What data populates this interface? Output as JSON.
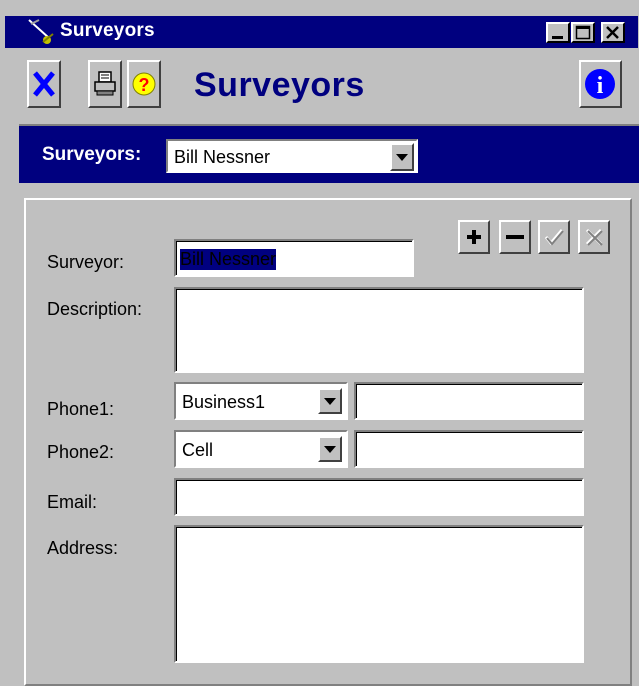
{
  "window": {
    "title": "Surveyors"
  },
  "toolbar": {
    "close_icon": "x-icon",
    "print_icon": "printer-icon",
    "help_icon": "question-icon",
    "info_icon": "info-icon",
    "form_title": "Surveyors"
  },
  "header": {
    "label": "Surveyors:",
    "selected": "Bill Nessner"
  },
  "record_buttons": [
    "add-icon",
    "remove-icon",
    "check-icon",
    "cancel-icon"
  ],
  "form": {
    "surveyor": {
      "label": "Surveyor:",
      "value": "Bill Nessner"
    },
    "description": {
      "label": "Description:",
      "value": ""
    },
    "phone1": {
      "label": "Phone1:",
      "type": "Business1",
      "number": ""
    },
    "phone2": {
      "label": "Phone2:",
      "type": "Cell",
      "number": ""
    },
    "email": {
      "label": "Email:",
      "value": ""
    },
    "address": {
      "label": "Address:",
      "value": ""
    }
  },
  "colors": {
    "titlebar": "#00007f",
    "face": "#c0c0c0",
    "accent": "#00007f"
  }
}
